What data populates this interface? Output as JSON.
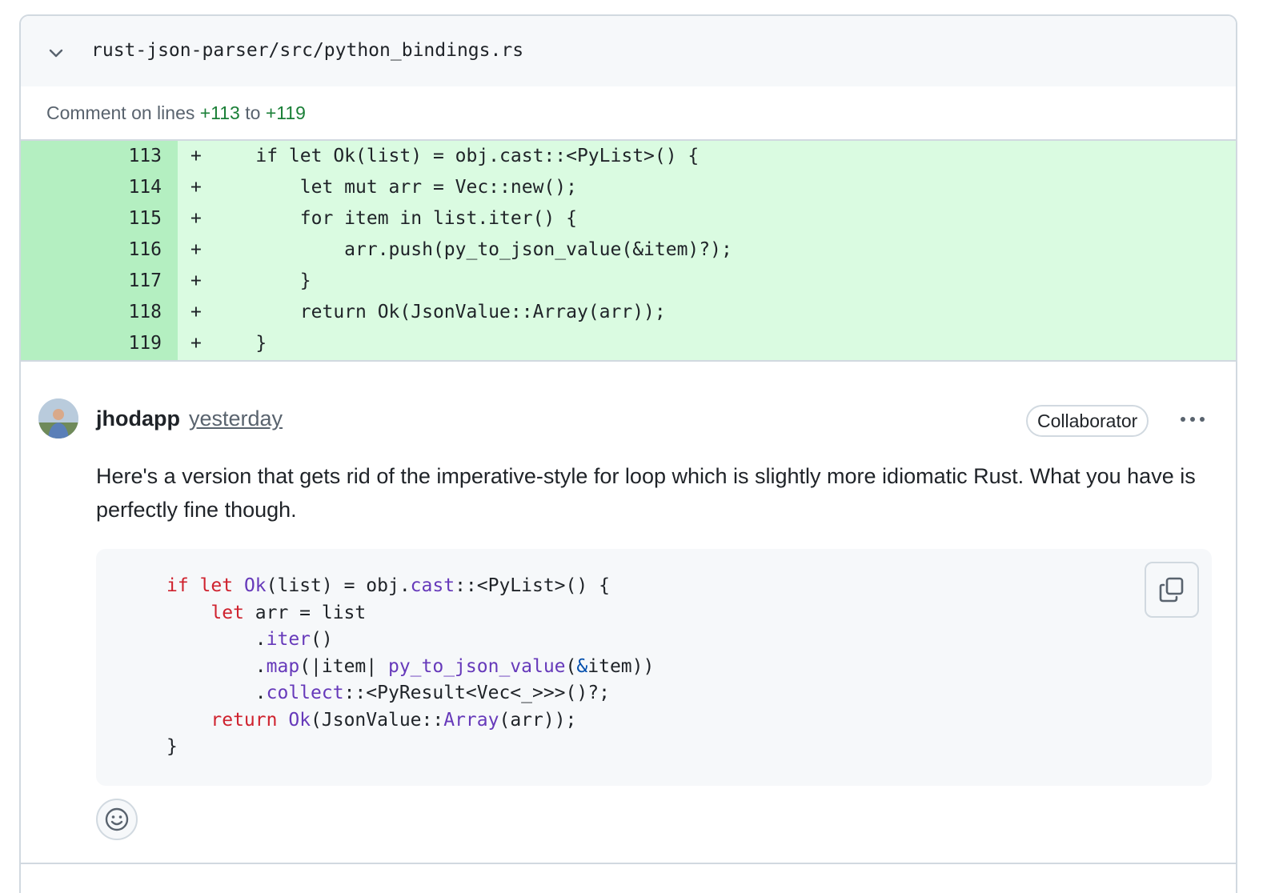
{
  "file": {
    "path": "rust-json-parser/src/python_bindings.rs"
  },
  "comment_range": {
    "prefix": "Comment on lines",
    "start": "+113",
    "sep": "to",
    "end": "+119"
  },
  "diff_lines": [
    {
      "num": "113",
      "sign": "+",
      "code": "    if let Ok(list) = obj.cast::<PyList>() {"
    },
    {
      "num": "114",
      "sign": "+",
      "code": "        let mut arr = Vec::new();"
    },
    {
      "num": "115",
      "sign": "+",
      "code": "        for item in list.iter() {"
    },
    {
      "num": "116",
      "sign": "+",
      "code": "            arr.push(py_to_json_value(&item)?);"
    },
    {
      "num": "117",
      "sign": "+",
      "code": "        }"
    },
    {
      "num": "118",
      "sign": "+",
      "code": "        return Ok(JsonValue::Array(arr));"
    },
    {
      "num": "119",
      "sign": "+",
      "code": "    }"
    }
  ],
  "comment": {
    "author": "jhodapp",
    "time": "yesterday",
    "role": "Collaborator",
    "body": "Here's a version that gets rid of the imperative-style for loop which is slightly more idiomatic Rust. What you have is perfectly fine though.",
    "code": {
      "l1": {
        "kw1": "if let",
        "fn1": "Ok",
        "t1": "(list) = obj.",
        "fn2": "cast",
        "t2": "::<PyList>() {"
      },
      "l2": {
        "kw1": "let",
        "t1": " arr = list"
      },
      "l3": {
        "t1": ".",
        "fn1": "iter",
        "t2": "()"
      },
      "l4": {
        "t1": ".",
        "fn1": "map",
        "t2": "(|item| ",
        "fn2": "py_to_json_value",
        "t3": "(",
        "amp": "&",
        "t4": "item))"
      },
      "l5": {
        "t1": ".",
        "fn1": "collect",
        "t2": "::<PyResult<Vec<_>>>()?;"
      },
      "l6": {
        "kw1": "return",
        "t1": " ",
        "fn1": "Ok",
        "t2": "(JsonValue::",
        "fn2": "Array",
        "t3": "(arr));"
      },
      "l7": {
        "t1": "}"
      }
    }
  },
  "icons": {
    "collapse": "chevron-down-icon",
    "more": "kebab-horizontal-icon",
    "copy": "copy-icon",
    "reaction": "smiley-icon"
  },
  "colors": {
    "added_bg": "#dafbe1",
    "added_gutter": "#b4efc1",
    "keyword": "#cf222e",
    "function": "#6639ba",
    "line_ref": "#1a7f37"
  }
}
